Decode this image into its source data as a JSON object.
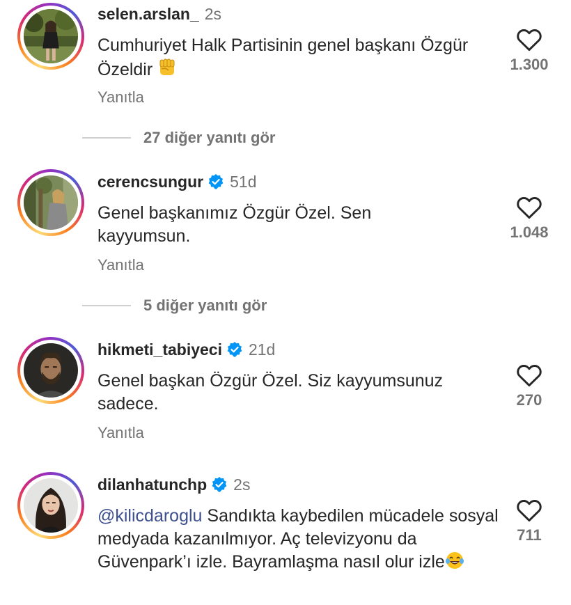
{
  "comments": [
    {
      "username": "selen.arslan_",
      "verified": false,
      "time": "2s",
      "text": "Cumhuriyet Halk Partisinin genel başkanı Özgür Özeldir",
      "emoji": "✊",
      "reply_label": "Yanıtla",
      "likes": "1.300"
    },
    {
      "username": "cerencsungur",
      "verified": true,
      "time": "51d",
      "text": "Genel başkanımız Özgür Özel. Sen kayyumsun.",
      "reply_label": "Yanıtla",
      "likes": "1.048"
    },
    {
      "username": "hikmeti_tabiyeci",
      "verified": true,
      "time": "21d",
      "text": "Genel başkan Özgür Özel. Siz kayyumsunuz sadece.",
      "reply_label": "Yanıtla",
      "likes": "270"
    },
    {
      "username": "dilanhatunchp",
      "verified": true,
      "time": "2s",
      "mention": "@kilicdaroglu",
      "text": "Sandıkta kaybedilen mücadele sosyal medyada kazanılmıyor. Aç televizyonu da Güvenpark’ı izle. Bayramlaşma nasıl olur izle",
      "emoji": "😂",
      "likes": "711"
    }
  ],
  "view_replies": [
    "27 diğer yanıtı gör",
    "5 diğer yanıtı gör"
  ],
  "colors": {
    "verified": "#0095f6",
    "mention": "#3d4f8f",
    "secondary_text": "#737373"
  },
  "icons": {
    "like": "heart-outline-icon",
    "verified": "verified-badge-icon"
  }
}
